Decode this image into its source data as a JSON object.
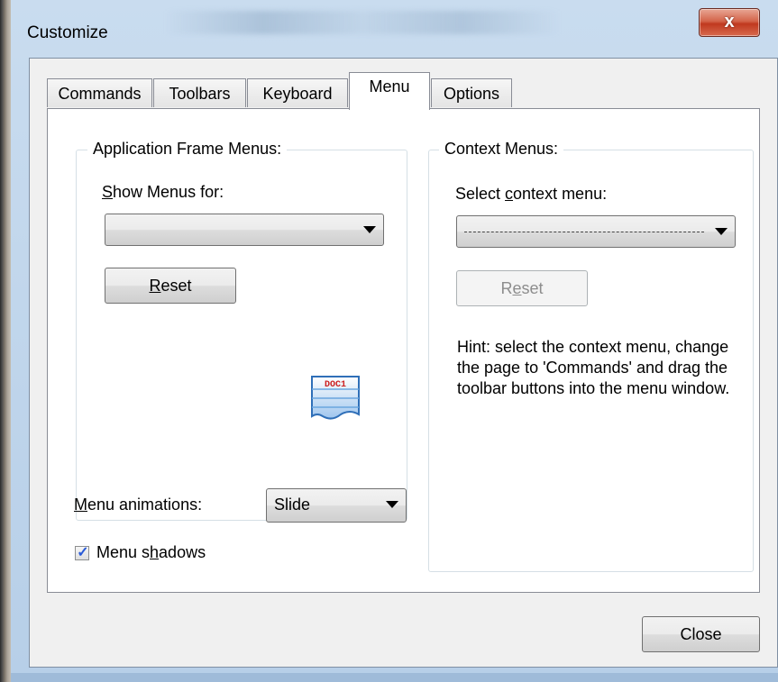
{
  "window": {
    "title": "Customize",
    "close_glyph": "x"
  },
  "tabs": [
    {
      "label": "Commands",
      "active": false
    },
    {
      "label": "Toolbars",
      "active": false
    },
    {
      "label": "Keyboard",
      "active": false
    },
    {
      "label": "Menu",
      "active": true
    },
    {
      "label": "Options",
      "active": false
    }
  ],
  "app_frame_menus": {
    "caption": "Application Frame Menus:",
    "show_menus_for": {
      "prefix": "",
      "mnemonic": "S",
      "rest": "how Menus for:"
    },
    "combo_value": "",
    "reset_button": {
      "mnemonic": "R",
      "rest": "eset"
    },
    "icon_text": "DOC1",
    "icon": "document-icon"
  },
  "context_menus": {
    "caption": "Context Menus:",
    "select_label": {
      "prefix": "Select ",
      "mnemonic": "c",
      "rest": "ontext menu:"
    },
    "combo_value": "--------------------------------------",
    "reset_button": {
      "prefix": "R",
      "mnemonic": "e",
      "rest": "set"
    },
    "hint": "Hint: select the context menu, change the page to 'Commands' and drag the toolbar buttons into the menu window."
  },
  "menu_animations": {
    "label": {
      "mnemonic": "M",
      "rest": "enu animations:"
    },
    "value": "Slide"
  },
  "menu_shadows": {
    "label": {
      "prefix": "Menu s",
      "mnemonic": "h",
      "rest": "adows"
    },
    "checked": true,
    "check_glyph": "✓"
  },
  "footer": {
    "close_label": "Close"
  },
  "colors": {
    "title_bar": "#b7cfe8",
    "close_button": "#c0391f",
    "dialog_bg": "#f0f0f0",
    "page_bg": "#ffffff",
    "check_color": "#2a5bd7"
  }
}
